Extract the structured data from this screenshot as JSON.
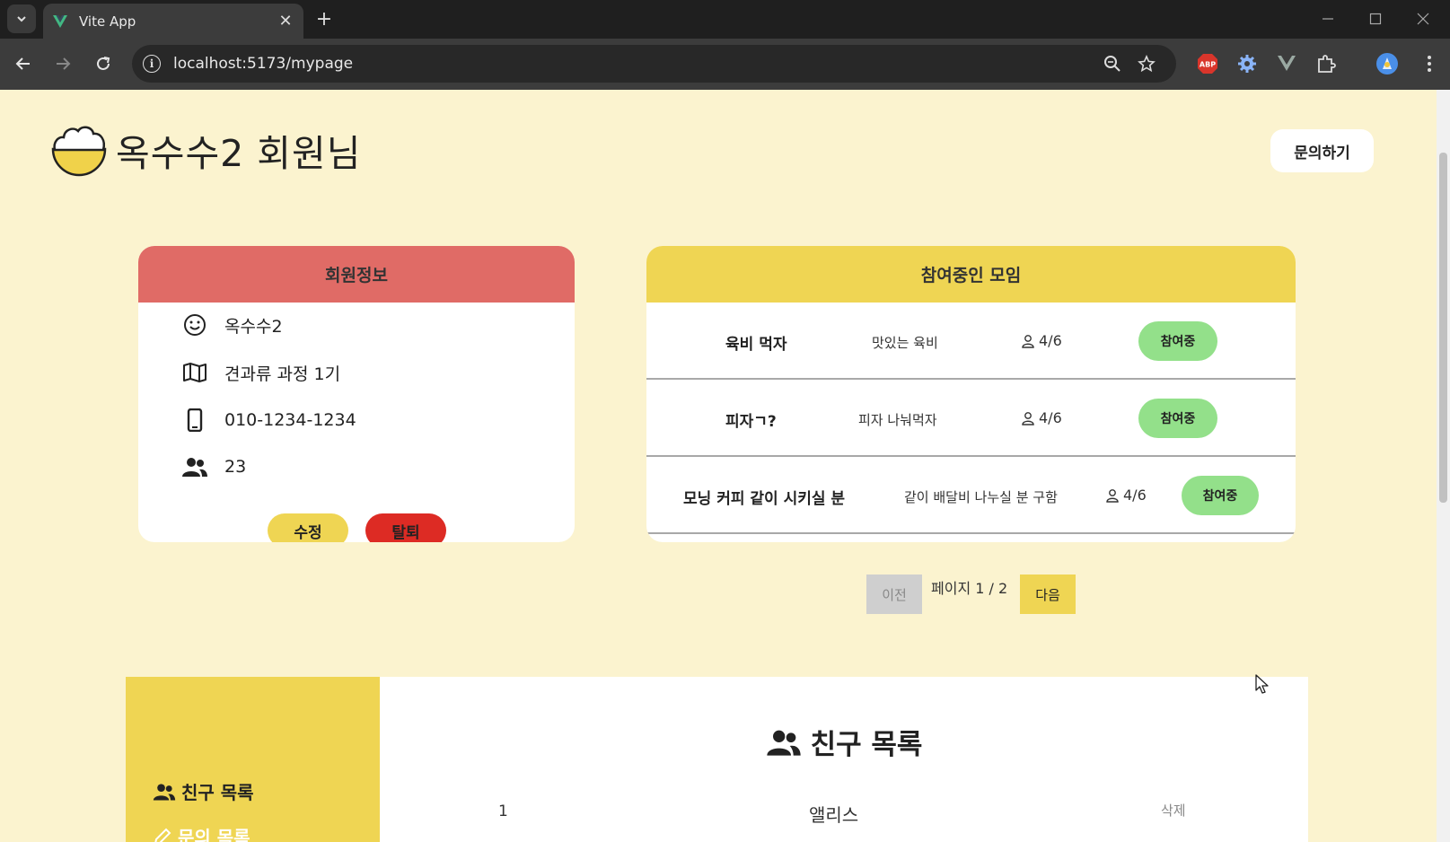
{
  "browser": {
    "tab_title": "Vite App",
    "url": "localhost:5173/mypage",
    "icons": [
      "tab-list-icon",
      "vite-favicon",
      "close-icon",
      "plus-icon",
      "back-icon",
      "forward-icon",
      "reload-icon",
      "info-icon",
      "zoom-icon",
      "star-icon",
      "abp-extension-icon",
      "gear-extension-icon",
      "vue-devtools-icon",
      "puzzle-icon",
      "profile-icon",
      "menu-icon"
    ],
    "abp_label": "ABP"
  },
  "header": {
    "title": "옥수수2 회원님",
    "inquiry_label": "문의하기"
  },
  "member_info": {
    "heading": "회원정보",
    "nickname": "옥수수2",
    "course": "견과류 과정 1기",
    "phone": "010-1234-1234",
    "friends": "23",
    "edit_label": "수정",
    "leave_label": "탈퇴"
  },
  "meetings": {
    "heading": "참여중인 모임",
    "items": [
      {
        "name": "육비 먹자",
        "desc": "맛있는 육비",
        "count": "4/6",
        "status": "참여중"
      },
      {
        "name": "피자ㄱ?",
        "desc": "피자 나눠먹자",
        "count": "4/6",
        "status": "참여중"
      },
      {
        "name": "모닝 커피 같이 시키실 분",
        "desc": "같이 배달비 나누실 분 구함",
        "count": "4/6",
        "status": "참여중"
      }
    ]
  },
  "pagination": {
    "prev_label": "이전",
    "info": "페이지 1 / 2",
    "next_label": "다음"
  },
  "side_menu": {
    "friends_label": "친구 목록",
    "inquiries_label": "문의 목록"
  },
  "friends": {
    "title": "친구 목록",
    "rows": [
      {
        "no": "1",
        "name": "앨리스",
        "delete_label": "삭제"
      }
    ]
  },
  "colors": {
    "page_bg": "#fbf3cf",
    "accent_yellow": "#efd553",
    "member_header_red": "#e06b66",
    "leave_red": "#dd2b24",
    "status_green": "#93e08a"
  }
}
